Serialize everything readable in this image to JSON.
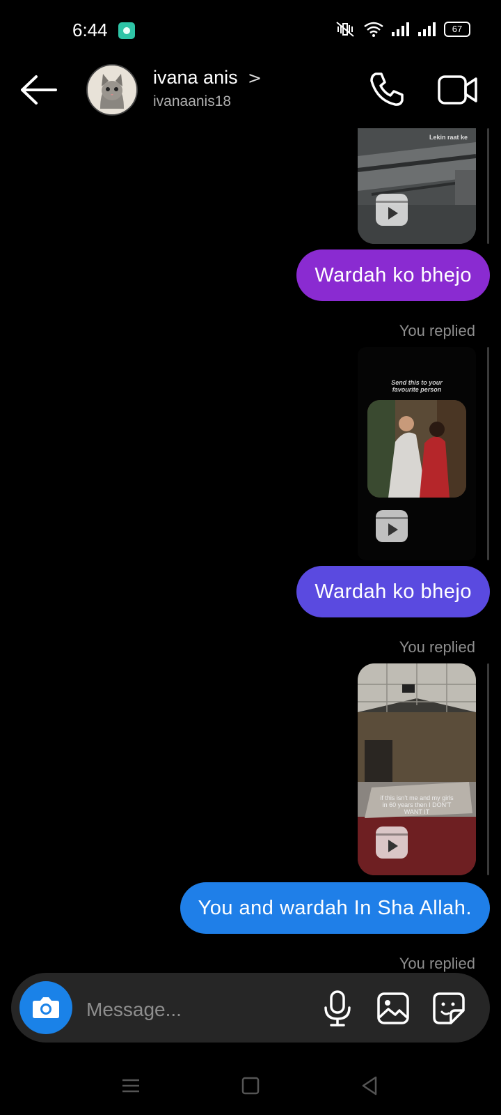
{
  "status_bar": {
    "time": "6:44",
    "battery": "67"
  },
  "header": {
    "name": "ivana anis",
    "chevron": ">",
    "username": "ivanaanis18"
  },
  "messages": {
    "bubble1": {
      "text": "Wardah ko bhejo",
      "color": "#8a2bd1"
    },
    "reply1": "You replied",
    "reel2_caption": "Send this to your favourite person",
    "bubble2": {
      "text": "Wardah ko bhejo",
      "color": "#5a4ae0"
    },
    "reply2": "You replied",
    "reel3_caption": "if this isn't me and my girls in 60 years then I DON'T WANT IT",
    "bubble3": {
      "text": "You and wardah In Sha Allah.",
      "color": "#1f7fe8"
    },
    "reply3": "You replied",
    "reel1_caption": "Lekin raat ke"
  },
  "composer": {
    "placeholder": "Message..."
  },
  "icons": {
    "back": "arrow-left-icon",
    "call": "phone-icon",
    "video": "video-camera-icon",
    "camera": "camera-icon",
    "mic": "microphone-icon",
    "gallery": "image-icon",
    "sticker": "sticker-icon",
    "reel": "reels-icon"
  }
}
